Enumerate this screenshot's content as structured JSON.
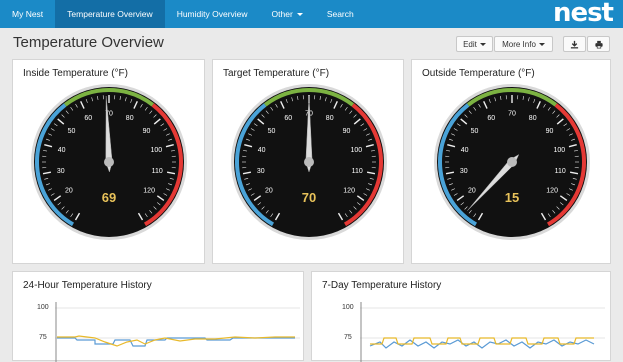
{
  "nav": {
    "items": [
      "My Nest",
      "Temperature Overview",
      "Humidity Overview",
      "Other",
      "Search"
    ],
    "logo": "nest"
  },
  "page": {
    "title": "Temperature Overview",
    "edit_label": "Edit",
    "more_info_label": "More Info",
    "download_icon": "download-icon",
    "print_icon": "print-icon"
  },
  "gauges": [
    {
      "title": "Inside Temperature (°F)",
      "value": "69",
      "reading": 69
    },
    {
      "title": "Target Temperature (°F)",
      "value": "70",
      "reading": 70
    },
    {
      "title": "Outside Temperature (°F)",
      "value": "15",
      "reading": 15
    }
  ],
  "gauge_scale": {
    "min": 10,
    "max": 130,
    "ticks": [
      "20",
      "30",
      "40",
      "50",
      "60",
      "70",
      "80",
      "90",
      "100",
      "110",
      "120"
    ],
    "bands": [
      {
        "from": 10,
        "to": 55,
        "color": "#4aa3d8"
      },
      {
        "from": 55,
        "to": 85,
        "color": "#7cb342"
      },
      {
        "from": 85,
        "to": 130,
        "color": "#e53935"
      }
    ]
  },
  "history": [
    {
      "title": "24-Hour Temperature History",
      "y_labels": [
        "100",
        "75"
      ]
    },
    {
      "title": "7-Day Temperature History",
      "y_labels": [
        "100",
        "75"
      ]
    }
  ],
  "colors": {
    "nav_bg": "#1b8ac7",
    "nav_active": "#136ea6",
    "value_text": "#e8c25a",
    "series_a": "#5b9bd5",
    "series_b": "#e8b92b"
  }
}
